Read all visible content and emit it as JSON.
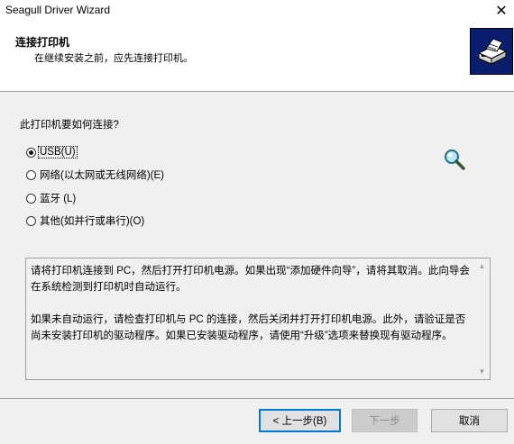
{
  "window": {
    "title": "Seagull Driver Wizard",
    "close_glyph": "✕"
  },
  "header": {
    "title": "连接打印机",
    "subtitle": "在继续安装之前，应先连接打印机。",
    "logo_icon": "printer-icon"
  },
  "main": {
    "question": "此打印机要如何连接?",
    "options": [
      {
        "label": "USB(U)",
        "selected": true
      },
      {
        "label": "网络(以太网或无线网络)(E)",
        "selected": false
      },
      {
        "label": "蓝牙 (L)",
        "selected": false
      },
      {
        "label": "其他(如并行或串行)(O)",
        "selected": false
      }
    ],
    "search_icon": "magnifier-icon",
    "info_paragraph_1": "请将打印机连接到 PC，然后打开打印机电源。如果出现“添加硬件向导”，请将其取消。此向导会在系统检测到打印机时自动运行。",
    "info_paragraph_2": "如果未自动运行，请检查打印机与 PC 的连接，然后关闭并打开打印机电源。此外，请验证是否尚未安装打印机的驱动程序。如果已安装驱动程序，请使用“升级”选项来替换现有驱动程序。"
  },
  "footer": {
    "back_label": "< 上一步(B)",
    "next_label": "下一步",
    "cancel_label": "取消"
  },
  "colors": {
    "logo_background": "#0b1e6e",
    "focus_border": "#0078d7",
    "dialog_background": "#f0f0f0"
  }
}
